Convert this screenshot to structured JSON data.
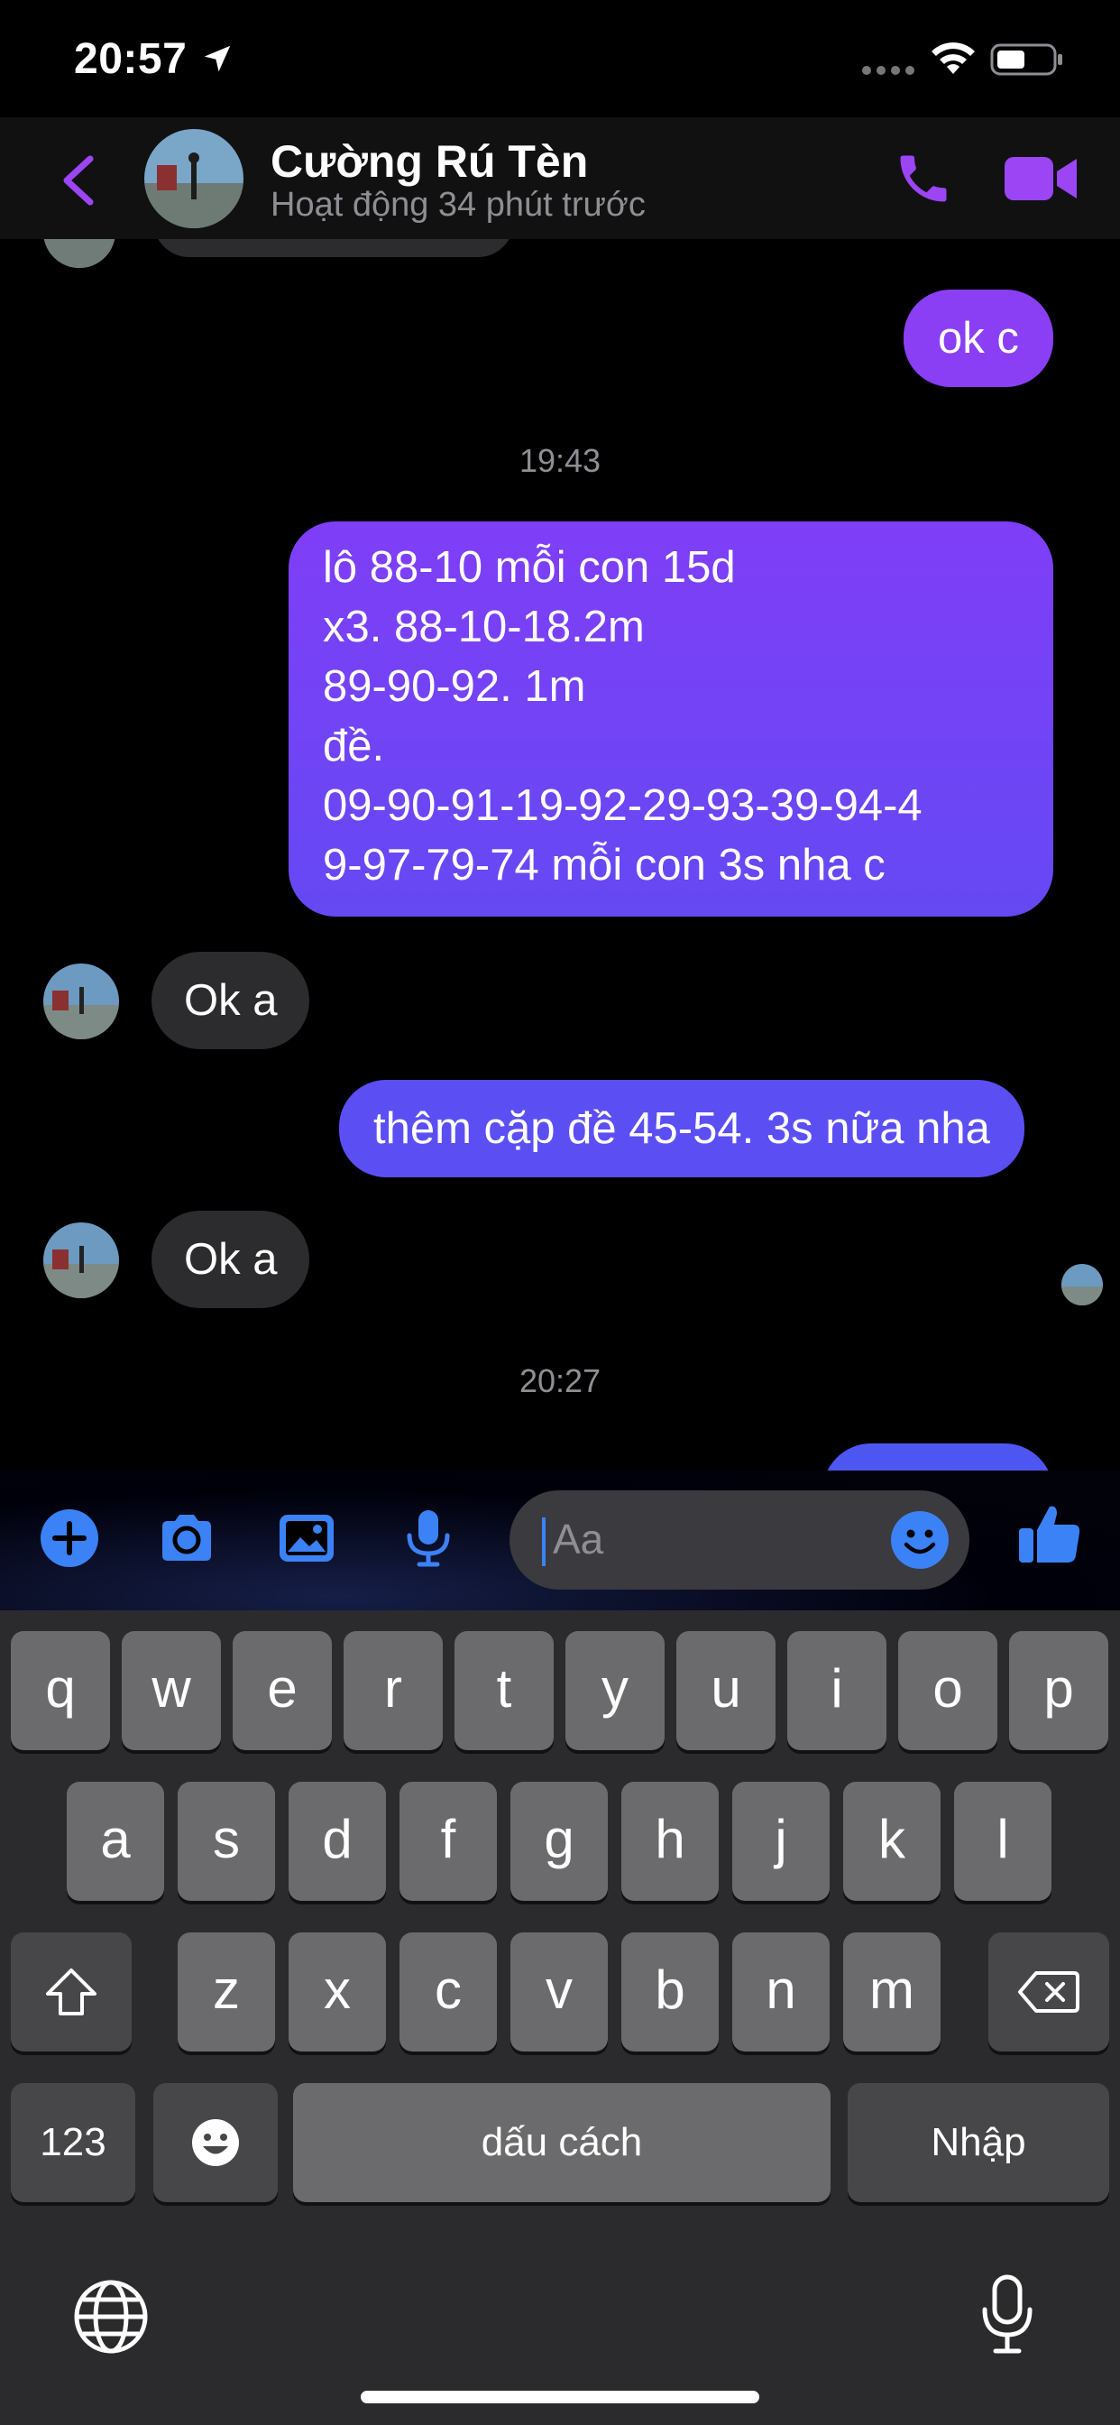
{
  "status_bar": {
    "time": "20:57"
  },
  "header": {
    "contact_name": "Cường Rú Tèn",
    "activity_status": "Hoạt động 34 phút trước"
  },
  "messages": [
    {
      "direction": "outgoing",
      "text": "ok c"
    },
    {
      "type": "timestamp",
      "text": "19:43"
    },
    {
      "direction": "outgoing",
      "lines": [
        "lô 88-10 mỗi con 15d",
        "x3. 88-10-18.2m",
        "89-90-92. 1m",
        "đề.",
        "09-90-91-19-92-29-93-39-94-4",
        "9-97-79-74 mỗi con 3s nha c"
      ]
    },
    {
      "direction": "incoming",
      "text": "Ok a"
    },
    {
      "direction": "outgoing",
      "text": "thêm cặp đề 45-54. 3s nữa nha"
    },
    {
      "direction": "incoming",
      "text": "Ok a"
    },
    {
      "type": "timestamp",
      "text": "20:27"
    }
  ],
  "composer": {
    "placeholder": "Aa"
  },
  "keyboard": {
    "row1": [
      "q",
      "w",
      "e",
      "r",
      "t",
      "y",
      "u",
      "i",
      "o",
      "p"
    ],
    "row2": [
      "a",
      "s",
      "d",
      "f",
      "g",
      "h",
      "j",
      "k",
      "l"
    ],
    "row3": [
      "z",
      "x",
      "c",
      "v",
      "b",
      "n",
      "m"
    ],
    "numbers_key": "123",
    "space_key": "dấu cách",
    "return_key": "Nhập"
  },
  "colors": {
    "accent_purple": "#8a3ff5",
    "messenger_blue": "#3b82f6",
    "bubble_incoming": "#2c2c2e"
  }
}
